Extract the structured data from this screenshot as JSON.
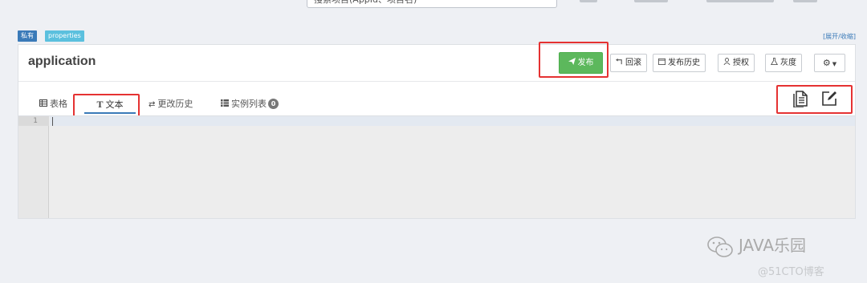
{
  "search": {
    "value": "搜索项目(AppId、项目名)"
  },
  "tags": {
    "private": "私有",
    "format": "properties"
  },
  "collapse_label": "[展开/收缩]",
  "namespace": {
    "title": "application"
  },
  "toolbar": {
    "publish_label": "发布",
    "rollback_label": "回滚",
    "history_label": "发布历史",
    "grant_label": "授权",
    "gray_label": "灰度"
  },
  "tabs": {
    "table": "表格",
    "text": "文本",
    "history": "更改历史",
    "instances": "实例列表",
    "instances_count": "0"
  },
  "editor": {
    "line_number": "1"
  },
  "watermark": {
    "brand": "JAVA乐园",
    "site": "@51CTO博客"
  },
  "colors": {
    "accent": "#3a7ab8",
    "publish": "#5cb85c",
    "highlight": "#e53232"
  },
  "icons": {
    "publish": "paper-plane-icon",
    "rollback": "rollback-icon",
    "history": "calendar-icon",
    "grant": "user-icon",
    "gray": "flask-icon",
    "settings": "gear-icon",
    "table": "table-icon",
    "text": "text-icon",
    "change_history": "exchange-icon",
    "instances": "list-icon",
    "copy": "copy-doc-icon",
    "edit": "edit-icon"
  }
}
